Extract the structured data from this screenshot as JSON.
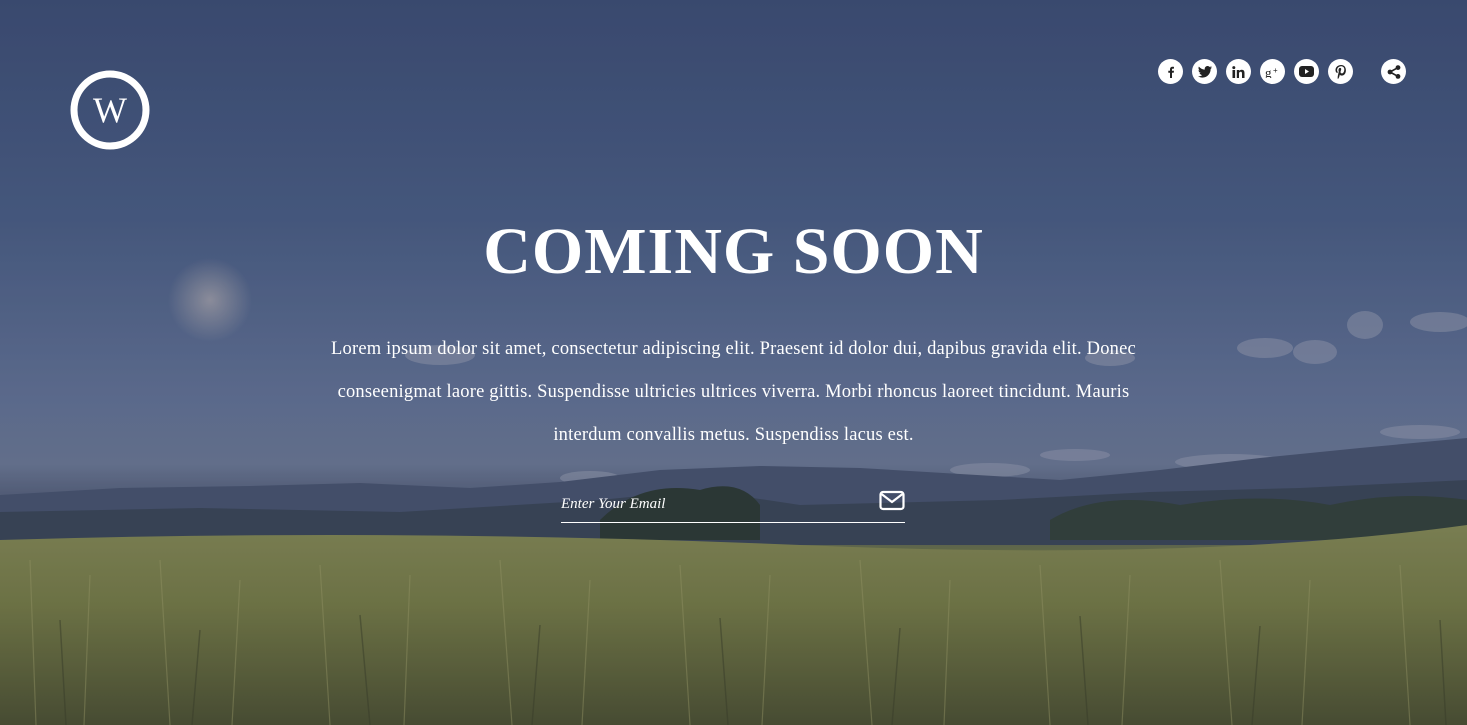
{
  "hero": {
    "title": "COMING SOON",
    "description": "Lorem ipsum dolor sit amet, consectetur adipiscing elit. Praesent id dolor dui, dapibus gravida elit. Donec conseenigmat laore gittis. Suspendisse ultricies ultrices viverra. Morbi rhoncus laoreet tincidunt. Mauris interdum convallis metus. Suspendiss lacus est."
  },
  "subscribe": {
    "placeholder": "Enter Your Email",
    "submit_icon": "envelope-icon"
  },
  "logo": {
    "icon": "wordpress-logo",
    "letter": "W"
  },
  "social": [
    {
      "icon": "facebook-icon"
    },
    {
      "icon": "twitter-icon"
    },
    {
      "icon": "linkedin-icon"
    },
    {
      "icon": "google-plus-icon"
    },
    {
      "icon": "youtube-icon"
    },
    {
      "icon": "pinterest-icon"
    },
    {
      "icon": "share-icon"
    }
  ],
  "colors": {
    "text": "#ffffff",
    "sky": "#4c5f86",
    "field": "#7f8548",
    "icon_glyph": "#222222"
  }
}
